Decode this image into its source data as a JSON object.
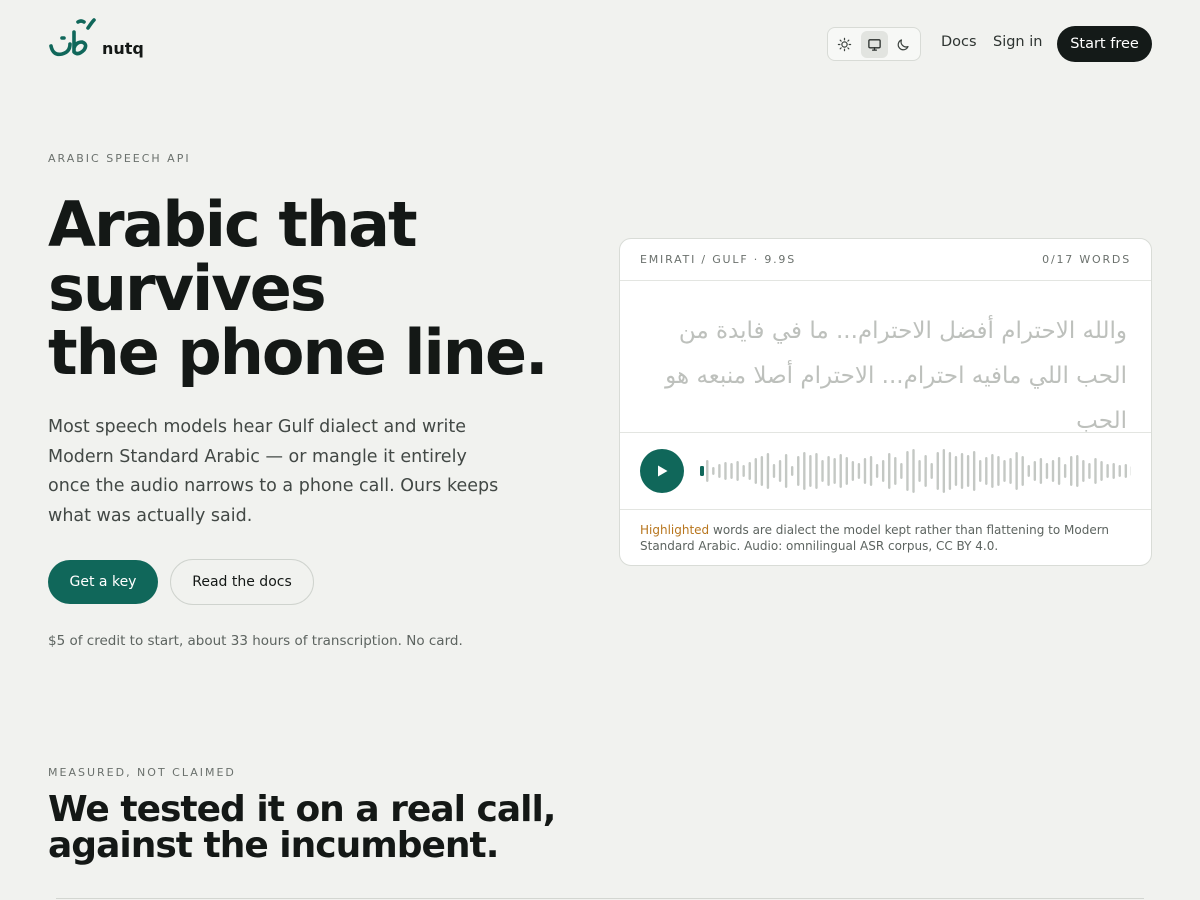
{
  "brand": {
    "logo_arabic": "نُطق",
    "name": "nutq",
    "accent": "#10675a"
  },
  "header": {
    "theme_icons": [
      "sun-icon",
      "monitor-icon",
      "moon-icon"
    ],
    "theme_selected": "monitor",
    "docs_label": "Docs",
    "signin_label": "Sign in",
    "start_label": "Start free"
  },
  "hero": {
    "eyebrow": "ARABIC SPEECH API",
    "title_lines": [
      "Arabic that",
      "survives",
      "the phone line."
    ],
    "description": "Most speech models hear Gulf dialect and write Modern Standard Arabic — or mangle it entirely once the audio narrows to a phone call. Ours keeps what was actually said.",
    "primary_cta": "Get a key",
    "secondary_cta": "Read the docs",
    "credit_note": "$5 of credit to start, about 33 hours of transcription. No card."
  },
  "transcript_card": {
    "dialect_label": "EMIRATI / GULF · 9.9S",
    "word_counter": "0/17 WORDS",
    "transcript": "والله الاحترام أفضل الاحترام... ما في فايدة من الحب اللي مافيه احترام... الاحترام أصلا منبعه هو الحب",
    "progress": 0,
    "footer_highlight": "Highlighted",
    "footer_text": " words are dialect the model kept rather than flattening to Modern Standard Arabic. Audio: omnilingual ASR corpus, CC BY 4.0.",
    "highlight_color": "#b8761e"
  },
  "section": {
    "eyebrow": "MEASURED, NOT CLAIMED",
    "title_lines": [
      "We tested it on a real call,",
      "against the incumbent."
    ]
  }
}
